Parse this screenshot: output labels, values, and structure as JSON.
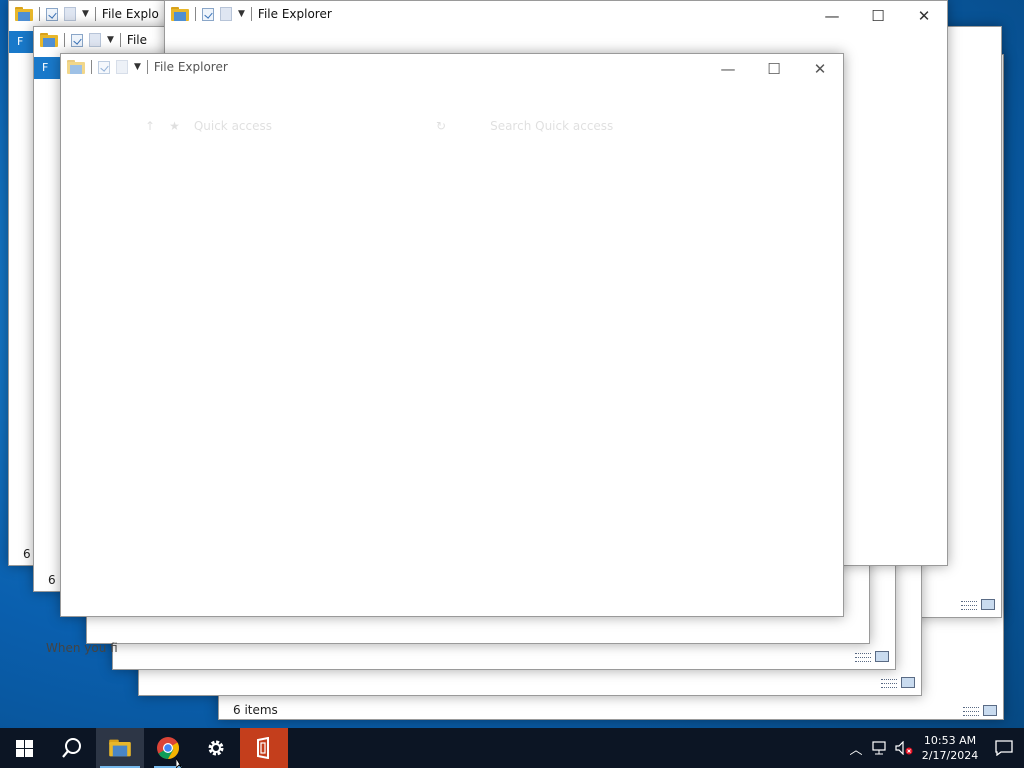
{
  "window_title": "File Explorer",
  "window_title_truncated_a": "File Explo",
  "window_title_truncated_b": "File",
  "ribbon_file_letter": "F",
  "status_count": "6 items",
  "status_count_short_a": "6 i",
  "status_count_short_b": "6 i",
  "hint_text": "When you fi",
  "front_window": {
    "title": "File Explorer",
    "address": "Quick access",
    "search_placeholder": "Search Quick access"
  },
  "help_label": "?",
  "taskbar": {
    "apps": [
      "start",
      "search",
      "file-explorer",
      "chrome",
      "settings",
      "office"
    ],
    "clock_time": "10:53 AM",
    "clock_date": "2/17/2024"
  },
  "colors": {
    "accent": "#1979ca",
    "taskbar": "#0c1524",
    "office": "#c43e1c"
  }
}
